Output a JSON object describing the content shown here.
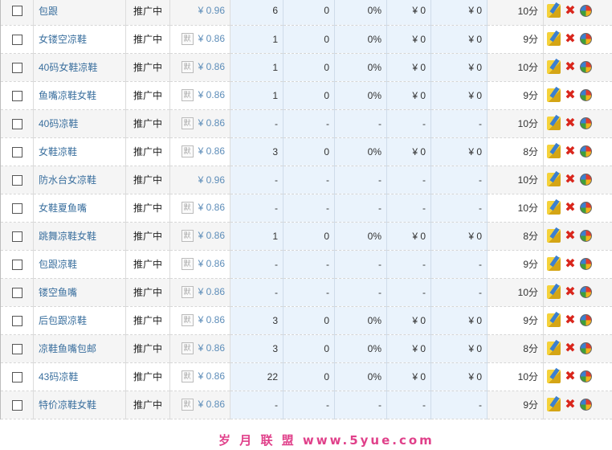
{
  "rows": [
    {
      "keyword": "包跟",
      "status": "推广中",
      "default": false,
      "price": "¥ 0.96",
      "impressions": "6",
      "clicks": "0",
      "ctr": "0%",
      "cpc": "¥ 0",
      "cost": "¥ 0",
      "rank": "10分"
    },
    {
      "keyword": "女镂空凉鞋",
      "status": "推广中",
      "default": true,
      "price": "¥ 0.86",
      "impressions": "1",
      "clicks": "0",
      "ctr": "0%",
      "cpc": "¥ 0",
      "cost": "¥ 0",
      "rank": "9分"
    },
    {
      "keyword": "40码女鞋凉鞋",
      "status": "推广中",
      "default": true,
      "price": "¥ 0.86",
      "impressions": "1",
      "clicks": "0",
      "ctr": "0%",
      "cpc": "¥ 0",
      "cost": "¥ 0",
      "rank": "10分"
    },
    {
      "keyword": "鱼嘴凉鞋女鞋",
      "status": "推广中",
      "default": true,
      "price": "¥ 0.86",
      "impressions": "1",
      "clicks": "0",
      "ctr": "0%",
      "cpc": "¥ 0",
      "cost": "¥ 0",
      "rank": "9分"
    },
    {
      "keyword": "40码凉鞋",
      "status": "推广中",
      "default": true,
      "price": "¥ 0.86",
      "impressions": "-",
      "clicks": "-",
      "ctr": "-",
      "cpc": "-",
      "cost": "-",
      "rank": "10分"
    },
    {
      "keyword": "女鞋凉鞋",
      "status": "推广中",
      "default": true,
      "price": "¥ 0.86",
      "impressions": "3",
      "clicks": "0",
      "ctr": "0%",
      "cpc": "¥ 0",
      "cost": "¥ 0",
      "rank": "8分"
    },
    {
      "keyword": "防水台女凉鞋",
      "status": "推广中",
      "default": false,
      "price": "¥ 0.96",
      "impressions": "-",
      "clicks": "-",
      "ctr": "-",
      "cpc": "-",
      "cost": "-",
      "rank": "10分"
    },
    {
      "keyword": "女鞋夏鱼嘴",
      "status": "推广中",
      "default": true,
      "price": "¥ 0.86",
      "impressions": "-",
      "clicks": "-",
      "ctr": "-",
      "cpc": "-",
      "cost": "-",
      "rank": "10分"
    },
    {
      "keyword": "跳舞凉鞋女鞋",
      "status": "推广中",
      "default": true,
      "price": "¥ 0.86",
      "impressions": "1",
      "clicks": "0",
      "ctr": "0%",
      "cpc": "¥ 0",
      "cost": "¥ 0",
      "rank": "8分"
    },
    {
      "keyword": "包跟凉鞋",
      "status": "推广中",
      "default": true,
      "price": "¥ 0.86",
      "impressions": "-",
      "clicks": "-",
      "ctr": "-",
      "cpc": "-",
      "cost": "-",
      "rank": "9分"
    },
    {
      "keyword": "镂空鱼嘴",
      "status": "推广中",
      "default": true,
      "price": "¥ 0.86",
      "impressions": "-",
      "clicks": "-",
      "ctr": "-",
      "cpc": "-",
      "cost": "-",
      "rank": "10分"
    },
    {
      "keyword": "后包跟凉鞋",
      "status": "推广中",
      "default": true,
      "price": "¥ 0.86",
      "impressions": "3",
      "clicks": "0",
      "ctr": "0%",
      "cpc": "¥ 0",
      "cost": "¥ 0",
      "rank": "9分"
    },
    {
      "keyword": "凉鞋鱼嘴包邮",
      "status": "推广中",
      "default": true,
      "price": "¥ 0.86",
      "impressions": "3",
      "clicks": "0",
      "ctr": "0%",
      "cpc": "¥ 0",
      "cost": "¥ 0",
      "rank": "8分"
    },
    {
      "keyword": "43码凉鞋",
      "status": "推广中",
      "default": true,
      "price": "¥ 0.86",
      "impressions": "22",
      "clicks": "0",
      "ctr": "0%",
      "cpc": "¥ 0",
      "cost": "¥ 0",
      "rank": "10分"
    },
    {
      "keyword": "特价凉鞋女鞋",
      "status": "推广中",
      "default": true,
      "price": "¥ 0.86",
      "impressions": "-",
      "clicks": "-",
      "ctr": "-",
      "cpc": "-",
      "cost": "-",
      "rank": "9分"
    }
  ],
  "default_badge": "默",
  "icons": {
    "edit": "edit-pencil-icon",
    "delete": "delete-x-icon",
    "report": "pie-chart-icon"
  },
  "colors": {
    "keyword_link": "#3a6f9e",
    "price": "#5d8db9",
    "highlight_col": "#eaf3fc",
    "delete": "#d9261c"
  },
  "watermark": "岁 月 联 盟  www.5yue.com"
}
